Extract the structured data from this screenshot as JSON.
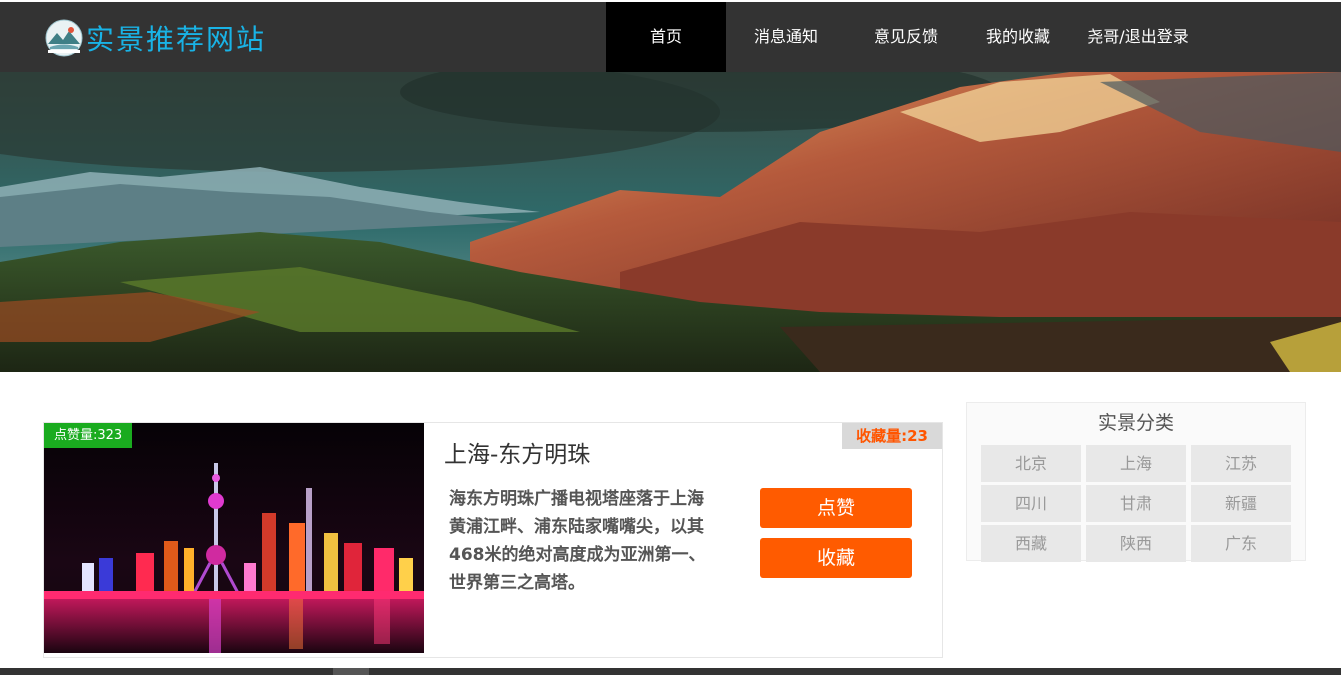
{
  "header": {
    "site_title": "实景推荐网站",
    "logo_icon": "landscape-logo-icon",
    "nav": [
      {
        "label": "首页",
        "active": true
      },
      {
        "label": "消息通知",
        "active": false
      },
      {
        "label": "意见反馈",
        "active": false
      },
      {
        "label": "我的收藏",
        "active": false
      },
      {
        "label": "尧哥/退出登录",
        "active": false
      }
    ]
  },
  "banner": {
    "image": "mountain-landscape-banner"
  },
  "card": {
    "like_badge": "点赞量:323",
    "fav_badge": "收藏量:23",
    "title": "上海-东方明珠",
    "description": "海东方明珠广播电视塔座落于上海黄浦江畔、浦东陆家嘴嘴尖，以其468米的绝对高度成为亚洲第一、世界第三之高塔。",
    "like_button": "点赞",
    "fav_button": "收藏",
    "image": "oriental-pearl-tower-night-photo"
  },
  "sidebar": {
    "title": "实景分类",
    "categories": [
      "北京",
      "上海",
      "江苏",
      "四川",
      "甘肃",
      "新疆",
      "西藏",
      "陕西",
      "广东"
    ]
  },
  "colors": {
    "header_bg": "#333333",
    "logo_text": "#19b3e6",
    "accent": "#ff5b00",
    "like_badge": "#1aab1f"
  }
}
